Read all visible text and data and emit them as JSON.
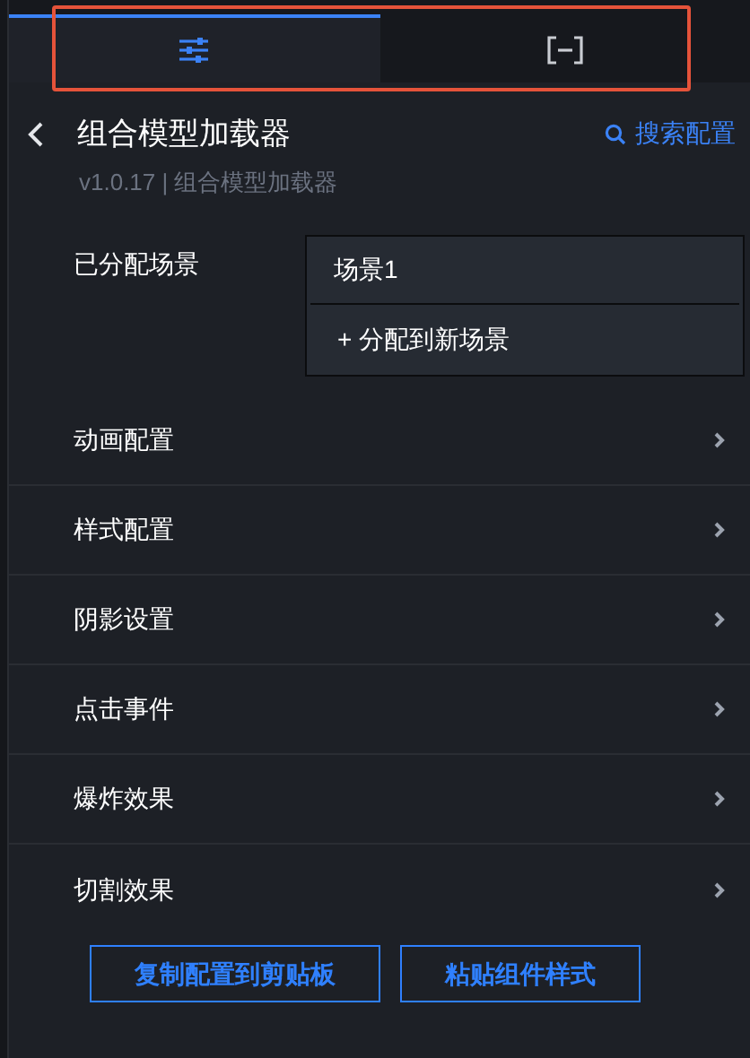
{
  "tab_bar": {
    "highlighted": true,
    "tabs": [
      {
        "kind": "settings",
        "selected": true
      },
      {
        "kind": "bracket",
        "selected": false
      }
    ]
  },
  "header": {
    "title": "组合模型加载器",
    "search_link": "搜索配置",
    "subtitle": "v1.0.17 | 组合模型加载器"
  },
  "scenes": {
    "label": "已分配场景",
    "items": [
      "场景1"
    ],
    "add_action": "+ 分配到新场景"
  },
  "sections": [
    {
      "label": "动画配置",
      "expanded": false
    },
    {
      "label": "样式配置",
      "expanded": false
    },
    {
      "label": "阴影设置",
      "expanded": false
    },
    {
      "label": "点击事件",
      "expanded": false
    },
    {
      "label": "爆炸效果",
      "expanded": false
    },
    {
      "label": "切割效果",
      "expanded": false
    }
  ],
  "buttons": [
    "复制配置到剪贴板",
    "粘贴组件样式"
  ]
}
